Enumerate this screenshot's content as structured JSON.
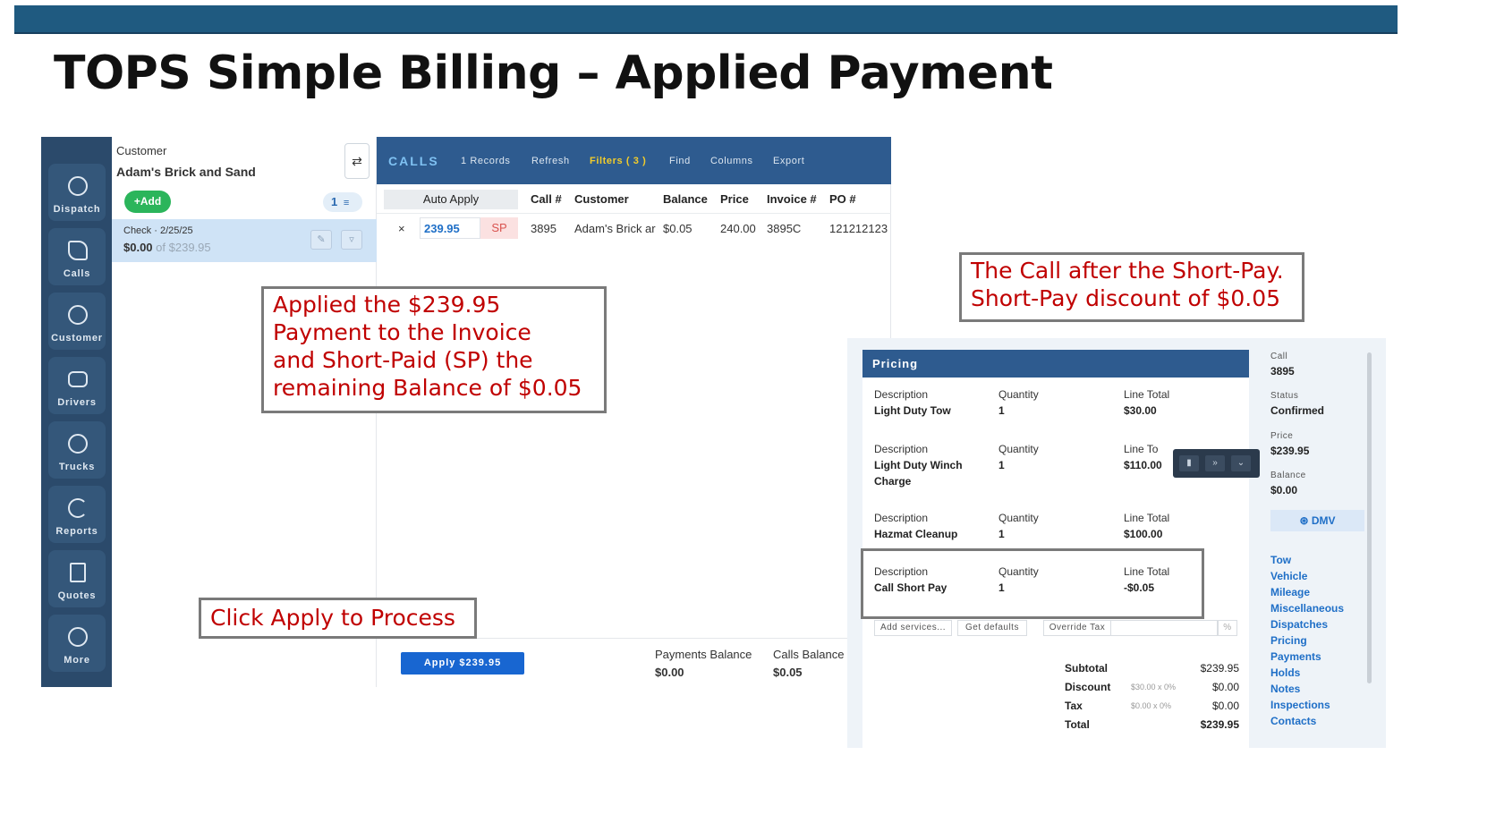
{
  "slide": {
    "title": "TOPS Simple Billing – Applied Payment"
  },
  "sidebar": {
    "items": [
      {
        "label": "Dispatch",
        "icon": "headset-icon"
      },
      {
        "label": "Calls",
        "icon": "phone-icon"
      },
      {
        "label": "Customer",
        "icon": "customer-icon"
      },
      {
        "label": "Drivers",
        "icon": "id-card-icon"
      },
      {
        "label": "Trucks",
        "icon": "steering-wheel-icon"
      },
      {
        "label": "Reports",
        "icon": "pie-chart-icon"
      },
      {
        "label": "Quotes",
        "icon": "dollar-document-icon"
      },
      {
        "label": "More",
        "icon": "more-icon"
      }
    ]
  },
  "customer_panel": {
    "label": "Customer",
    "name": "Adam's Brick and Sand",
    "swap_icon": "⇄",
    "add_label": "+Add",
    "filter_count": "1",
    "payment": {
      "line": "Check · 2/25/25",
      "applied": "$0.00",
      "of_total": "of $239.95"
    }
  },
  "calls": {
    "title": "CALLS",
    "records": "1 Records",
    "refresh": "Refresh",
    "filters": "Filters ( 3 )",
    "find": "Find",
    "columns_btn": "Columns",
    "export": "Export",
    "headers": {
      "auto_apply": "Auto Apply",
      "call_no": "Call #",
      "customer": "Customer",
      "balance": "Balance",
      "price": "Price",
      "invoice": "Invoice #",
      "po": "PO #"
    },
    "row": {
      "remove": "×",
      "amount": "239.95",
      "sp": "SP",
      "call_no": "3895",
      "customer": "Adam's Brick ar",
      "balance": "$0.05",
      "price": "240.00",
      "invoice": "3895C",
      "po": "121212123"
    }
  },
  "bottom": {
    "apply_label": "Apply $239.95",
    "payments_balance_label": "Payments Balance",
    "payments_balance": "$0.00",
    "calls_balance_label": "Calls Balance",
    "calls_balance": "$0.05"
  },
  "callouts": {
    "applied_lines": [
      "Applied the $239.95",
      "Payment to the Invoice",
      "and Short-Paid (SP) the",
      "remaining Balance of $0.05"
    ],
    "apply": "Click Apply to Process",
    "after_lines": [
      "The Call after the Short-Pay.",
      "Short-Pay discount of $0.05"
    ]
  },
  "pricing": {
    "title": "Pricing",
    "labels": {
      "description": "Description",
      "quantity": "Quantity",
      "line_total": "Line Total",
      "line_total_cut": "Line To"
    },
    "items": [
      {
        "desc": "Light Duty Tow",
        "desc2": "",
        "qty": "1",
        "total": "$30.00"
      },
      {
        "desc": "Light Duty Winch",
        "desc2": "Charge",
        "qty": "1",
        "total": "$110.00"
      },
      {
        "desc": "Hazmat Cleanup",
        "desc2": "",
        "qty": "1",
        "total": "$100.00"
      },
      {
        "desc": "Call Short Pay",
        "desc2": "",
        "qty": "1",
        "total": "-$0.05"
      }
    ],
    "buttons": {
      "add_services": "Add services...",
      "get_defaults": "Get defaults",
      "override_tax": "Override Tax",
      "percent": "%"
    },
    "totals": {
      "subtotal_label": "Subtotal",
      "subtotal": "$239.95",
      "discount_label": "Discount",
      "discount_calc": "$30.00 x 0%",
      "discount": "$0.00",
      "tax_label": "Tax",
      "tax_calc": "$0.00 x 0%",
      "tax": "$0.00",
      "total_label": "Total",
      "total": "$239.95"
    }
  },
  "call_info": {
    "call_label": "Call",
    "call": "3895",
    "status_label": "Status",
    "status": "Confirmed",
    "price_label": "Price",
    "price": "$239.95",
    "balance_label": "Balance",
    "balance": "$0.00",
    "dmv_label": "DMV",
    "links": [
      "Tow",
      "Vehicle",
      "Mileage",
      "Miscellaneous",
      "Dispatches",
      "Pricing",
      "Payments",
      "Holds",
      "Notes",
      "Inspections",
      "Contacts"
    ]
  },
  "colors": {
    "nav": "#2b4a6b",
    "header": "#2e5b8f",
    "accent": "#1866d1",
    "callout_text": "#c00000",
    "add": "#2bb55b"
  }
}
